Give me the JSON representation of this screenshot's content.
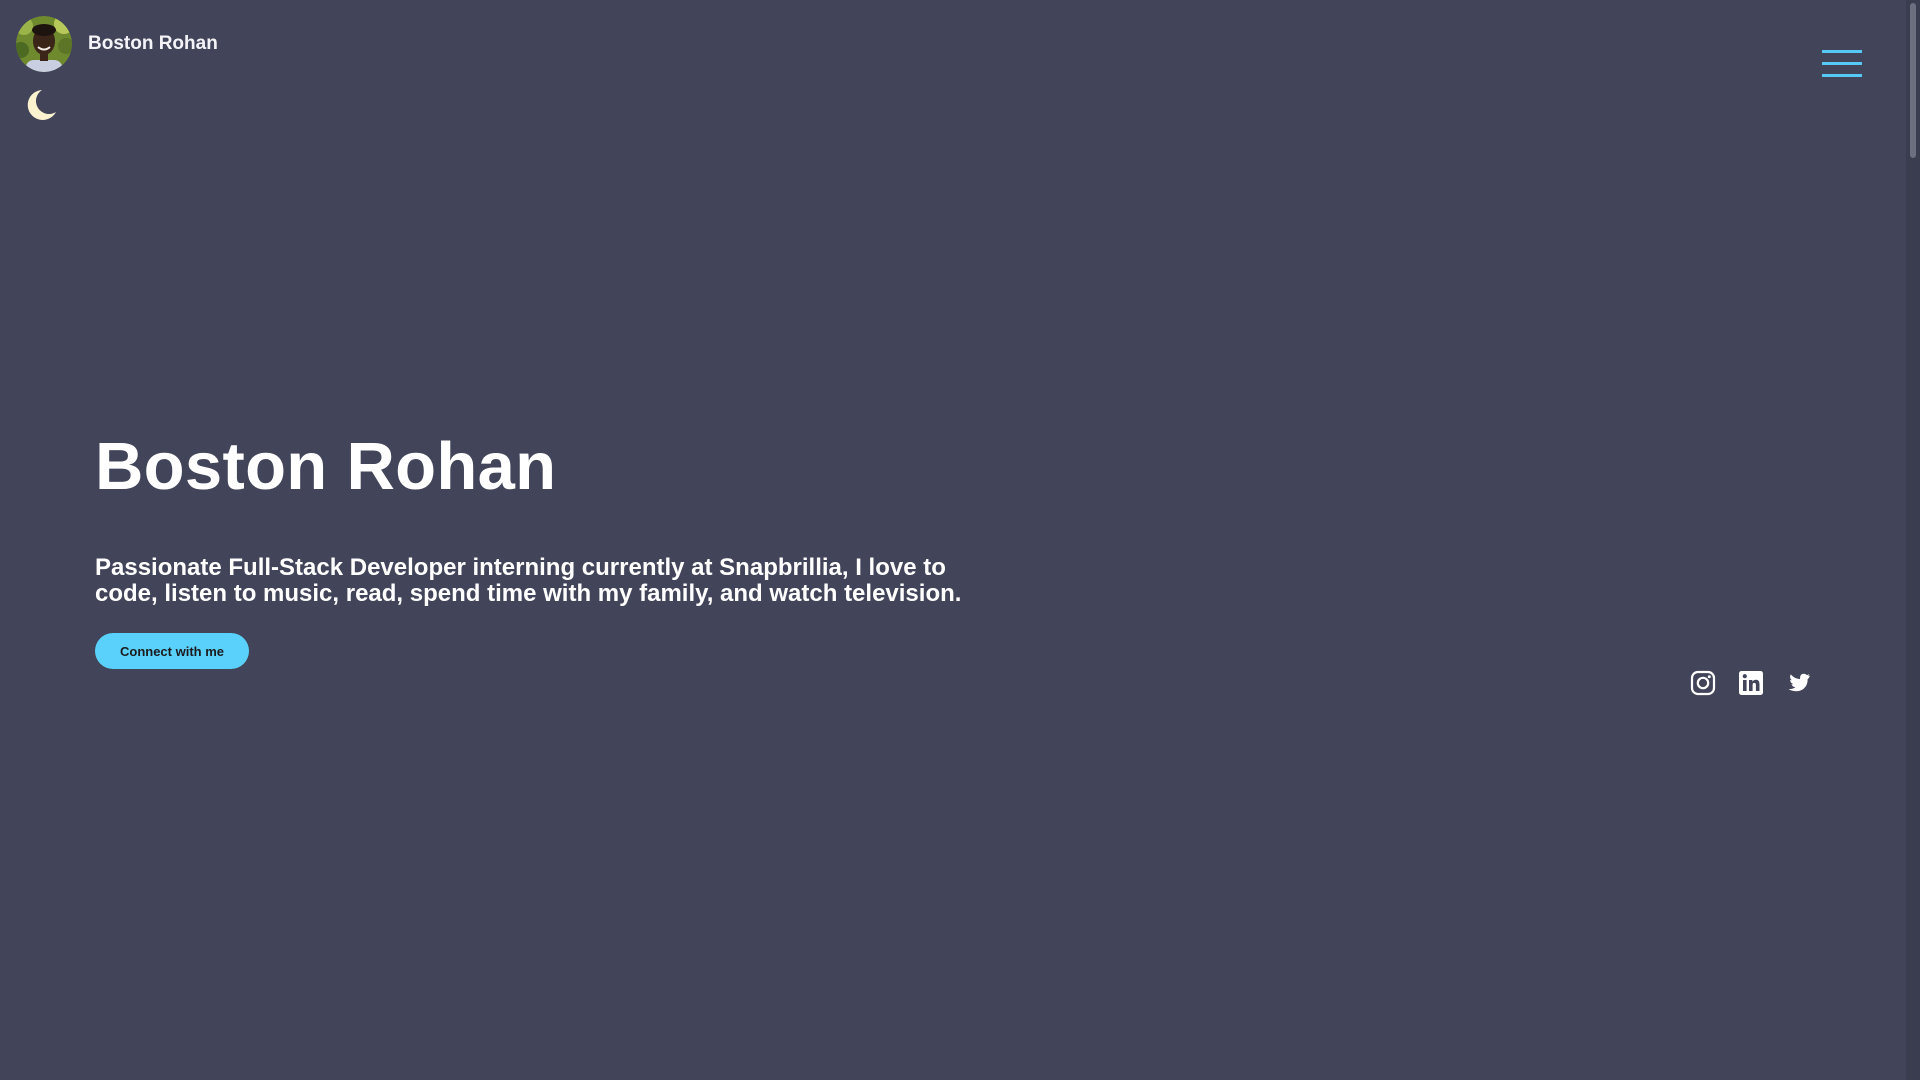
{
  "header": {
    "brand_name": "Boston Rohan",
    "avatar_icon": "profile-photo",
    "theme_toggle_icon": "moon-icon",
    "menu_icon": "hamburger-menu-icon"
  },
  "hero": {
    "title": "Boston Rohan",
    "description": "Passionate Full-Stack Developer interning currently at Snapbrillia, I love to code, listen to music, read, spend time with my family, and watch television.",
    "cta_label": "Connect with me"
  },
  "socials": [
    {
      "icon": "instagram-icon"
    },
    {
      "icon": "linkedin-icon"
    },
    {
      "icon": "twitter-icon"
    }
  ],
  "colors": {
    "background": "#424559",
    "accent": "#5ad1fb",
    "moon": "#fbf3d0",
    "text": "#ffffff"
  }
}
